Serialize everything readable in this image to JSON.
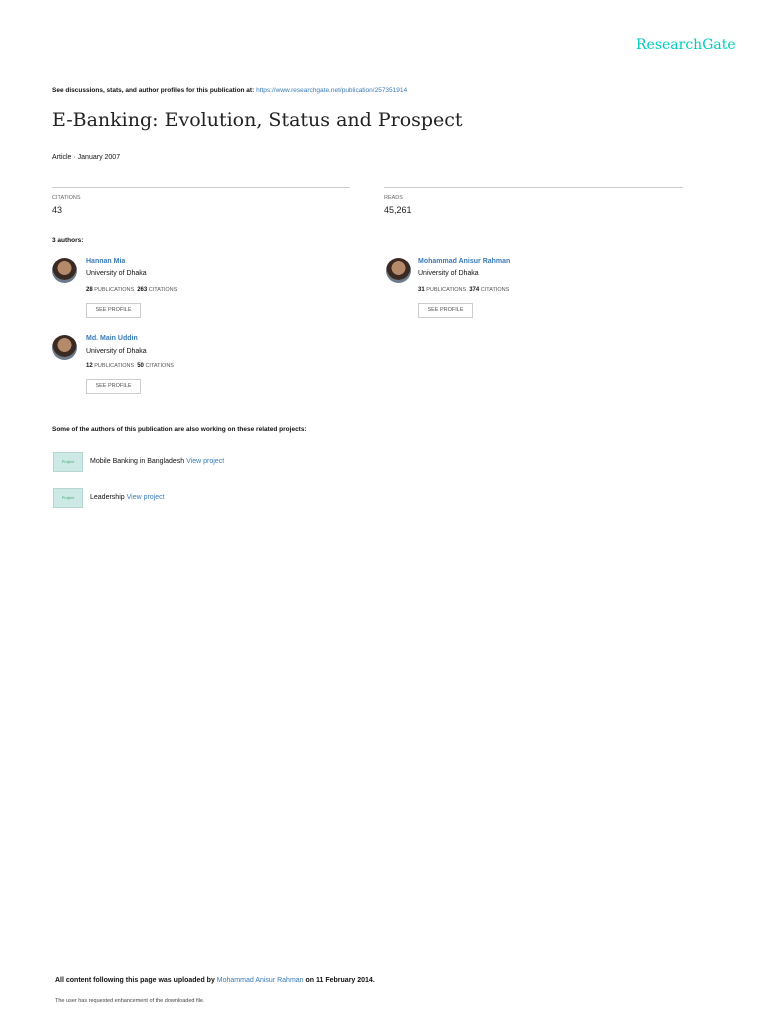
{
  "brand": "ResearchGate",
  "header": {
    "discussion_text": "See discussions, stats, and author profiles for this publication at:",
    "url": "https://www.researchgate.net/publication/257351914"
  },
  "title": "E-Banking: Evolution, Status and Prospect",
  "meta": "Article · January 2007",
  "stats": {
    "citations_label": "CITATIONS",
    "citations": "43",
    "reads_label": "READS",
    "reads": "45,261"
  },
  "authors_heading": "3 authors:",
  "authors": [
    {
      "name": "Hannan Mia",
      "affiliation": "University of Dhaka",
      "publications": "28",
      "publications_label": "PUBLICATIONS",
      "citations": "263",
      "citations_label": "CITATIONS",
      "button": "SEE PROFILE"
    },
    {
      "name": "Mohammad Anisur Rahman",
      "affiliation": "University of Dhaka",
      "publications": "31",
      "publications_label": "PUBLICATIONS",
      "citations": "374",
      "citations_label": "CITATIONS",
      "button": "SEE PROFILE"
    },
    {
      "name": "Md. Main Uddin",
      "affiliation": "University of Dhaka",
      "publications": "12",
      "publications_label": "PUBLICATIONS",
      "citations": "50",
      "citations_label": "CITATIONS",
      "button": "SEE PROFILE"
    }
  ],
  "projects_heading": "Some of the authors of this publication are also working on these related projects:",
  "projects": [
    {
      "icon_label": "Project",
      "name": "Mobile Banking in Bangladesh",
      "link": "View project"
    },
    {
      "icon_label": "Project",
      "name": "Leadership",
      "link": "View project"
    }
  ],
  "footer": {
    "prefix": "All content following this page was uploaded by",
    "uploader": "Mohammad Anisur Rahman",
    "suffix": "on 11 February 2014.",
    "note": "The user has requested enhancement of the downloaded file."
  }
}
